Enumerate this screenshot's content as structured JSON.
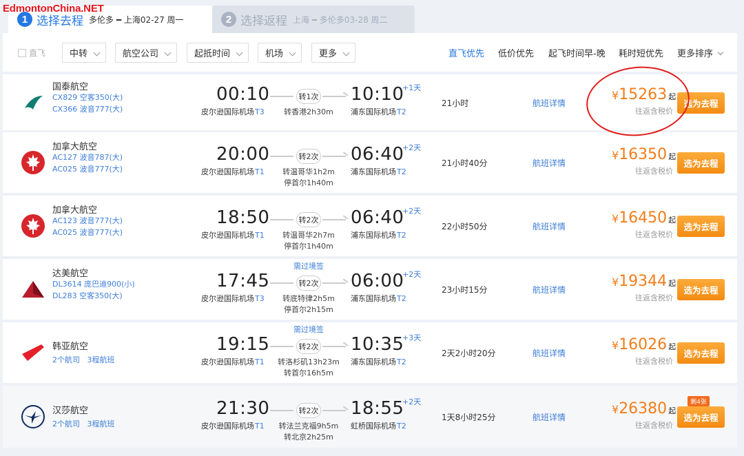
{
  "watermark": "EdmontonChina.NET",
  "tabs": [
    {
      "num": "1",
      "name": "选择去程",
      "route": "多伦多 ━ 上海02-27 周一"
    },
    {
      "num": "2",
      "name": "选择返程",
      "route": "上海 ━ 多伦多03-28 周二"
    }
  ],
  "filters": {
    "direct_only": "直飞",
    "dropdowns": [
      "中转",
      "航空公司",
      "起抵时间",
      "机场",
      "更多"
    ]
  },
  "sorts": [
    "直飞优先",
    "低价优先",
    "起飞时间早-晚",
    "耗时短优先",
    "更多排序"
  ],
  "colors": {
    "accent": "#2577e3",
    "price": "#f27d1b",
    "button": "#f48b12",
    "annotation": "#e01c1c"
  },
  "flights": [
    {
      "airline": "国泰航空",
      "logo": "cathay-logo-icon",
      "fl1": "CX829 空客350(大)",
      "fl2": "CX366 波音777(大)",
      "dep_time": "00:10",
      "dep_ap": "皮尔逊国际机场",
      "dep_term": "T3",
      "transfer": "转1次",
      "via1": "转香港2h30m",
      "via2": "",
      "visa": "",
      "arr_time": "10:10",
      "plus": "+1天",
      "arr_ap": "浦东国际机场",
      "arr_term": "T2",
      "duration": "21小时",
      "detail": "航班详情",
      "yen": "¥",
      "price": "15263",
      "qi": "起",
      "tax": "往返含税价",
      "button": "选为去程",
      "badge": ""
    },
    {
      "airline": "加拿大航空",
      "logo": "air-canada-logo-icon",
      "fl1": "AC127 波音787(大)",
      "fl2": "AC025 波音777(大)",
      "dep_time": "20:00",
      "dep_ap": "皮尔逊国际机场",
      "dep_term": "T1",
      "transfer": "转2次",
      "via1": "转温哥华1h2m",
      "via2": "停首尔1h40m",
      "visa": "",
      "arr_time": "06:40",
      "plus": "+2天",
      "arr_ap": "浦东国际机场",
      "arr_term": "T2",
      "duration": "21小时40分",
      "detail": "航班详情",
      "yen": "¥",
      "price": "16350",
      "qi": "起",
      "tax": "往返含税价",
      "button": "选为去程",
      "badge": ""
    },
    {
      "airline": "加拿大航空",
      "logo": "air-canada-logo-icon",
      "fl1": "AC123 波音777(大)",
      "fl2": "AC025 波音777(大)",
      "dep_time": "18:50",
      "dep_ap": "皮尔逊国际机场",
      "dep_term": "T1",
      "transfer": "转2次",
      "via1": "转温哥华2h7m",
      "via2": "停首尔1h40m",
      "visa": "",
      "arr_time": "06:40",
      "plus": "+2天",
      "arr_ap": "浦东国际机场",
      "arr_term": "T2",
      "duration": "22小时50分",
      "detail": "航班详情",
      "yen": "¥",
      "price": "16450",
      "qi": "起",
      "tax": "往返含税价",
      "button": "选为去程",
      "badge": ""
    },
    {
      "airline": "达美航空",
      "logo": "delta-logo-icon",
      "fl1": "DL3614 庞巴迪900(小)",
      "fl2": "DL283 空客350(大)",
      "dep_time": "17:45",
      "dep_ap": "皮尔逊国际机场",
      "dep_term": "T3",
      "transfer": "转2次",
      "via1": "转底特律2h5m",
      "via2": "停首尔2h15m",
      "visa": "需过境签",
      "arr_time": "06:00",
      "plus": "+2天",
      "arr_ap": "浦东国际机场",
      "arr_term": "T2",
      "duration": "23小时15分",
      "detail": "航班详情",
      "yen": "¥",
      "price": "19344",
      "qi": "起",
      "tax": "往返含税价",
      "button": "选为去程",
      "badge": ""
    },
    {
      "airline": "韩亚航空",
      "logo": "asiana-logo-icon",
      "fl1": "2个航司",
      "fl1b": "3程航班",
      "fl2": "",
      "dep_time": "19:15",
      "dep_ap": "皮尔逊国际机场",
      "dep_term": "T1",
      "transfer": "转2次",
      "via1": "转洛杉矶13h23m",
      "via2": "转首尔16h5m",
      "visa": "需过境签",
      "arr_time": "10:35",
      "plus": "+3天",
      "arr_ap": "浦东国际机场",
      "arr_term": "T2",
      "duration": "2天2小时20分",
      "detail": "航班详情",
      "yen": "¥",
      "price": "16026",
      "qi": "起",
      "tax": "往返含税价",
      "button": "选为去程",
      "badge": ""
    },
    {
      "airline": "汉莎航空",
      "logo": "lufthansa-logo-icon",
      "fl1": "2个航司",
      "fl1b": "3程航班",
      "fl2": "",
      "dep_time": "21:30",
      "dep_ap": "皮尔逊国际机场",
      "dep_term": "T1",
      "transfer": "转2次",
      "via1": "转法兰克福9h5m",
      "via2": "转北京2h25m",
      "visa": "",
      "arr_time": "18:55",
      "plus": "+2天",
      "arr_ap": "虹桥国际机场",
      "arr_term": "T2",
      "duration": "1天8小时25分",
      "detail": "航班详情",
      "yen": "¥",
      "price": "26380",
      "qi": "起",
      "tax": "往返含税价",
      "button": "选为去程",
      "badge": "剩4张"
    }
  ]
}
